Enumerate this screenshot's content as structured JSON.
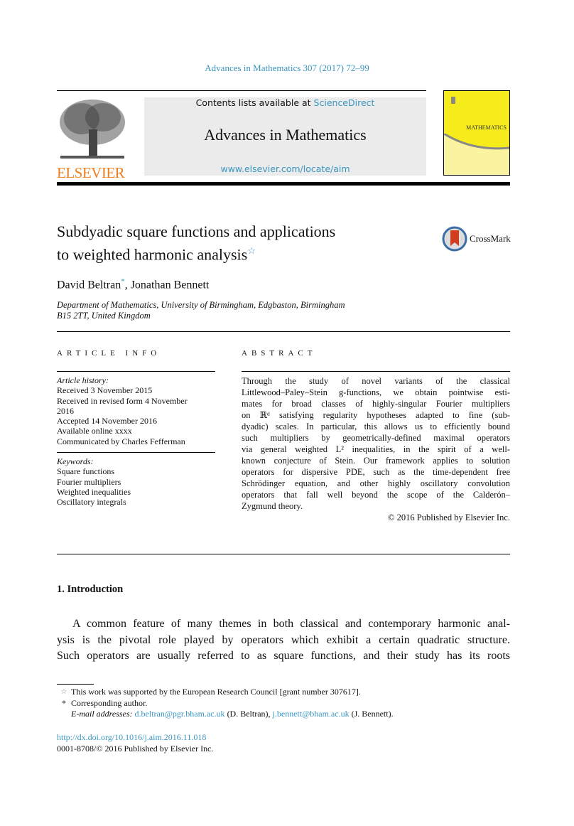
{
  "header": {
    "citation": "Advances in Mathematics 307 (2017) 72–99",
    "contents_prefix": "Contents lists available at ",
    "sciencedirect": "ScienceDirect",
    "journal_title": "Advances in Mathematics",
    "journal_url": "www.elsevier.com/locate/aim",
    "publisher_logo": "ELSEVIER",
    "cover_text": "MATHEMATICS",
    "colors": {
      "link": "#3a96c0",
      "elsevier_orange": "#f07e1b",
      "cover_yellow": "#f6ec1c",
      "banner_gray": "#ebebeb"
    }
  },
  "article": {
    "title_line1": "Subdyadic square functions and applications",
    "title_line2": "to weighted harmonic analysis",
    "title_mark": "☆",
    "crossmark": "CrossMark",
    "author1": "David Beltran",
    "author1_mark": "*",
    "author_sep": ", ",
    "author2": "Jonathan Bennett",
    "affiliation_line1": "Department of Mathematics, University of Birmingham, Edgbaston, Birmingham",
    "affiliation_line2": "B15 2TT, United Kingdom"
  },
  "info": {
    "heading": "ARTICLE INFO",
    "history_label": "Article history:",
    "history": [
      "Received 3 November 2015",
      "Received in revised form 4 November",
      "2016",
      "Accepted 14 November 2016",
      "Available online xxxx",
      "Communicated by Charles Fefferman"
    ],
    "keywords_label": "Keywords:",
    "keywords": [
      "Square functions",
      "Fourier multipliers",
      "Weighted inequalities",
      "Oscillatory integrals"
    ]
  },
  "abstract": {
    "heading": "ABSTRACT",
    "lines": [
      "Through the study of novel variants of the classical",
      "Littlewood–Paley–Stein g-functions, we obtain pointwise esti-",
      "mates for broad classes of highly-singular Fourier multipliers",
      "on ℝᵈ satisfying regularity hypotheses adapted to fine (sub-",
      "dyadic) scales. In particular, this allows us to efficiently bound",
      "such multipliers by geometrically-defined maximal operators",
      "via general weighted L² inequalities, in the spirit of a well-",
      "known conjecture of Stein. Our framework applies to solution",
      "operators for dispersive PDE, such as the time-dependent free",
      "Schrödinger equation, and other highly oscillatory convolution",
      "operators that fall well beyond the scope of the Calderón–",
      "Zygmund theory."
    ],
    "copyright": "© 2016 Published by Elsevier Inc."
  },
  "intro": {
    "heading": "1.  Introduction",
    "lines": [
      "A common feature of many themes in both classical and contemporary harmonic anal-",
      "ysis is the pivotal role played by operators which exhibit a certain quadratic structure.",
      "Such operators are usually referred to as square functions, and their study has its roots"
    ]
  },
  "footnotes": {
    "star_mark": "☆",
    "star_text": "This work was supported by the European Research Council [grant number 307617].",
    "corr_mark": "*",
    "corr_text": "Corresponding author.",
    "email_label": "E-mail addresses:",
    "email1": "d.beltran@pgr.bham.ac.uk",
    "email1_name": " (D. Beltran), ",
    "email2": "j.bennett@bham.ac.uk",
    "email2_name": " (J. Bennett).",
    "doi": "http://dx.doi.org/10.1016/j.aim.2016.11.018",
    "issn": "0001-8708/© 2016 Published by Elsevier Inc."
  }
}
